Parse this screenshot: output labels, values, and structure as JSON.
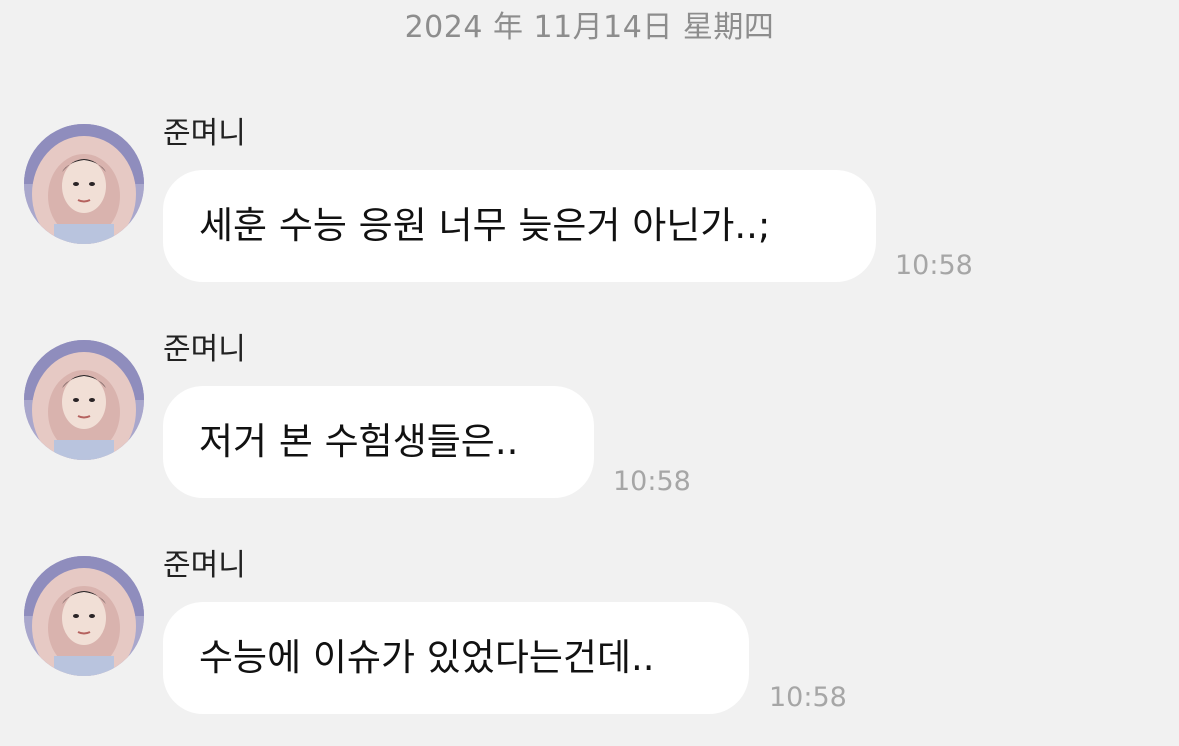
{
  "date_header": "2024 年 11月14日 星期四",
  "messages": [
    {
      "sender": "준며니",
      "text": "세훈 수능 응원 너무 늦은거 아닌가..;",
      "time": "10:58"
    },
    {
      "sender": "준며니",
      "text": "저거 본 수험생들은..",
      "time": "10:58"
    },
    {
      "sender": "준며니",
      "text": "수능에 이슈가 있었다는건데..",
      "time": "10:58"
    }
  ],
  "colors": {
    "background": "#f1f1f1",
    "bubble": "#ffffff",
    "timestamp": "#a6a6a6",
    "date_header": "#8d8d8d"
  },
  "icons": {
    "avatar": "profile-photo-avatar"
  }
}
